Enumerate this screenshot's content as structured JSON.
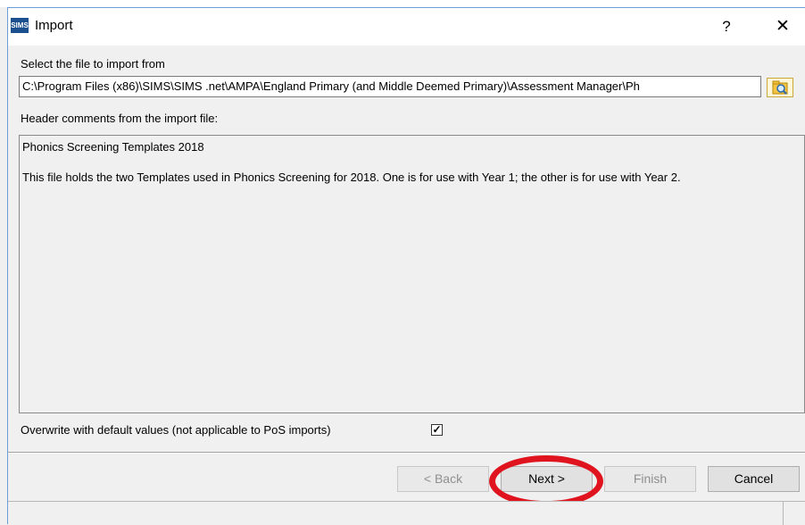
{
  "dialog": {
    "app_icon_text": "SIMS",
    "title": "Import",
    "help_glyph": "?",
    "close_glyph": "✕"
  },
  "file_section": {
    "label": "Select the file to import from",
    "path_value": "C:\\Program Files (x86)\\SIMS\\SIMS .net\\AMPA\\England Primary (and Middle Deemed Primary)\\Assessment Manager\\Ph",
    "browse_icon": "folder-search-icon"
  },
  "comments_section": {
    "label": "Header comments from the import file:",
    "line1": "Phonics Screening Templates 2018",
    "line2": "This file holds the two Templates used in Phonics Screening for 2018.  One is for use with Year 1; the other is for use with Year 2."
  },
  "overwrite": {
    "label": "Overwrite with default values (not applicable to PoS imports)",
    "checked": true,
    "check_glyph": "✓"
  },
  "buttons": {
    "back": "< Back",
    "next": "Next >",
    "finish": "Finish",
    "cancel": "Cancel"
  },
  "colors": {
    "highlight_ring": "#e0141e",
    "title_bar": "#ffffff",
    "dialog_bg": "#f0f0f0"
  }
}
